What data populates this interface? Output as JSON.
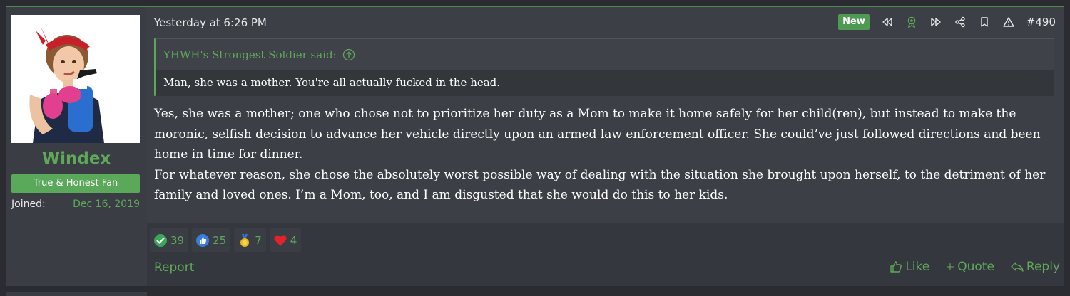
{
  "post": {
    "timestamp": "Yesterday at 6:26 PM",
    "new_badge": "New",
    "post_number": "#490",
    "header_icons": [
      "rewind-icon",
      "award-icon",
      "fast-forward-icon",
      "share-icon",
      "bookmark-icon",
      "warning-icon"
    ]
  },
  "user": {
    "name": "Windex",
    "title": "True & Honest Fan",
    "joined_label": "Joined:",
    "joined_date": "Dec 16, 2019"
  },
  "quote": {
    "author_line": "YHWH's Strongest Soldier said:",
    "text": "Man, she was a mother. You're all actually fucked in the head."
  },
  "message": {
    "paragraph1": "Yes, she was a mother; one who chose not to prioritize her duty as a Mom to make it home safely for her child(ren), but instead to make the moronic, selfish decision to advance her vehicle directly upon an armed law enforcement officer. She could’ve just followed directions and been home in time for dinner.",
    "paragraph2": "For whatever reason, she chose the absolutely worst possible way of dealing with the situation she brought upon herself, to the detriment of her family and loved ones. I’m a Mom, too, and I am disgusted that she would do this to her kids."
  },
  "reactions": [
    {
      "icon": "checkmark-icon",
      "count": "39"
    },
    {
      "icon": "thumbs-up-icon",
      "count": "25"
    },
    {
      "icon": "medal-icon",
      "count": "7"
    },
    {
      "icon": "heart-icon",
      "count": "4"
    }
  ],
  "footer": {
    "report": "Report",
    "like": "Like",
    "quote": "Quote",
    "reply": "Reply"
  },
  "colors": {
    "accent_green": "#5fa85a",
    "panel": "#3c3f45",
    "background": "#2a2c31"
  }
}
